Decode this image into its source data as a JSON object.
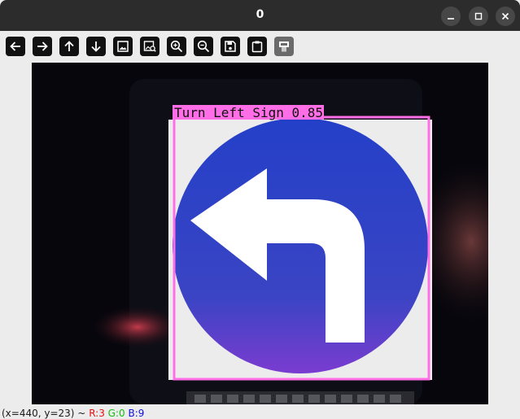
{
  "window": {
    "title": "0",
    "controls": {
      "minimize": "minimize",
      "maximize": "maximize",
      "close": "close"
    }
  },
  "toolbar": {
    "buttons": [
      {
        "name": "pan-left",
        "icon": "arrow-left-icon"
      },
      {
        "name": "pan-right",
        "icon": "arrow-right-icon"
      },
      {
        "name": "pan-up",
        "icon": "arrow-up-icon"
      },
      {
        "name": "pan-down",
        "icon": "arrow-down-icon"
      },
      {
        "name": "zoom-original",
        "icon": "image-icon"
      },
      {
        "name": "zoom-to-fit",
        "icon": "image-search-icon"
      },
      {
        "name": "zoom-in",
        "icon": "zoom-in-icon"
      },
      {
        "name": "zoom-out",
        "icon": "zoom-out-icon"
      },
      {
        "name": "save",
        "icon": "save-icon"
      },
      {
        "name": "copy-to-clipboard",
        "icon": "clipboard-icon"
      },
      {
        "name": "properties",
        "icon": "properties-icon"
      }
    ]
  },
  "detection": {
    "label": "Turn Left Sign 0.85",
    "box_color": "#ff6ee6"
  },
  "status": {
    "coords": "(x=440, y=23) ~",
    "r": "R:3",
    "g": "G:0",
    "b": "B:9"
  },
  "colors": {
    "titlebar": "#2c2c2c",
    "sign_blue": "#2e47c7",
    "sign_arrow": "#ffffff"
  }
}
